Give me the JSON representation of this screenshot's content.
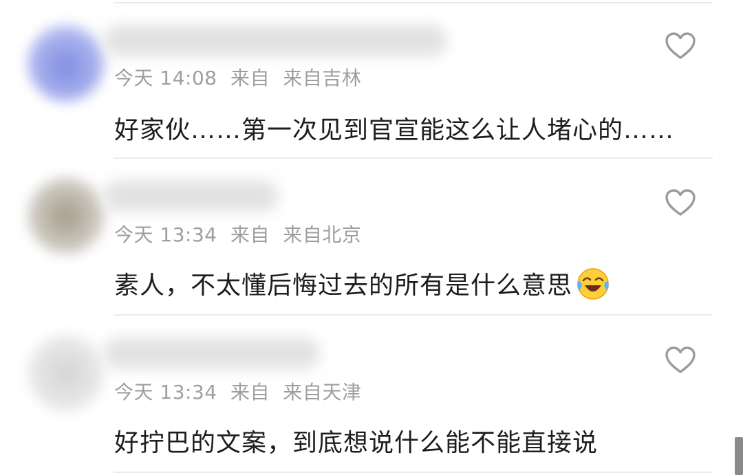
{
  "comments": [
    {
      "time": "今天 14:08",
      "source_prefix": "来自",
      "location": "来自吉林",
      "text": "好家伙……第一次见到官宣能这么让人堵心的……",
      "avatar_color": "#8a96e0",
      "icon": "heart-outline-icon"
    },
    {
      "time": "今天 13:34",
      "source_prefix": "来自",
      "location": "来自北京",
      "text": "素人，不太懂后悔过去的所有是什么意思",
      "emoji": "laughing-crying-emoji",
      "avatar_color": "#b8b2a6",
      "icon": "heart-outline-icon"
    },
    {
      "time": "今天 13:34",
      "source_prefix": "来自",
      "location": "来自天津",
      "text": "好拧巴的文案，到底想说什么能不能直接说",
      "avatar_color": "#dadada",
      "icon": "heart-outline-icon"
    }
  ],
  "colors": {
    "meta_text": "#9e9e9e",
    "body_text": "#1d1d1d",
    "divider": "#ececec",
    "icon": "#9b9b9b"
  }
}
